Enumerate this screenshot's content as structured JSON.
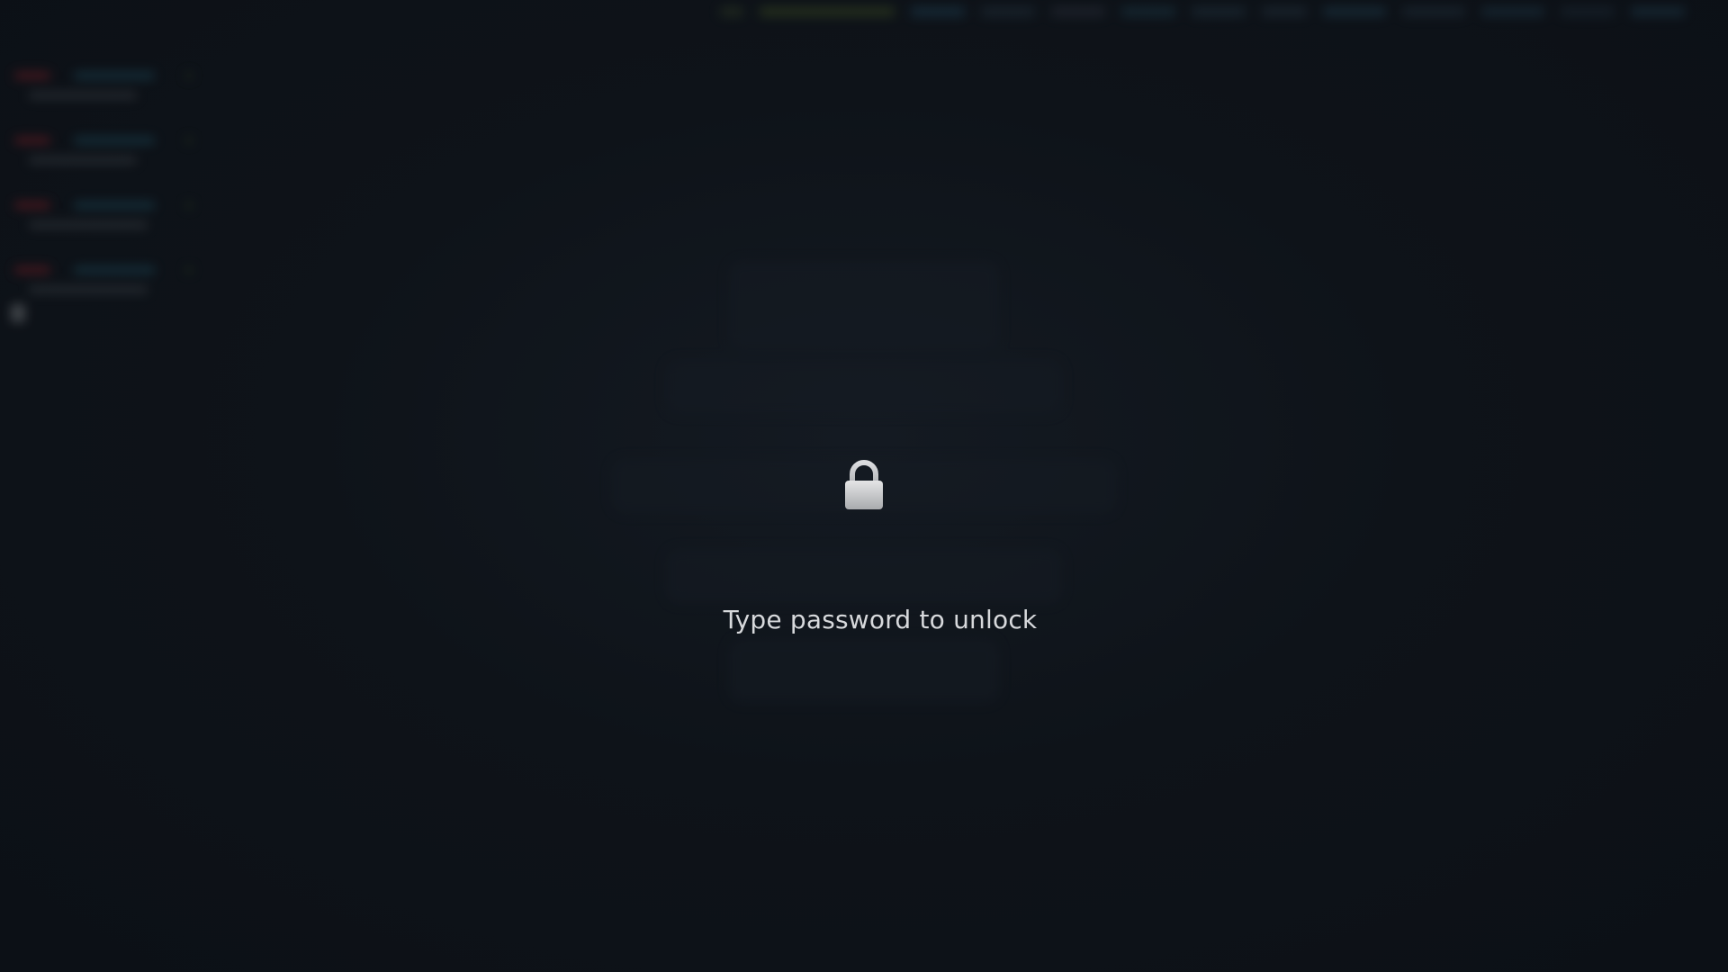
{
  "lock_screen": {
    "icon": "lock-icon",
    "prompt": "Type password to unlock"
  },
  "colors": {
    "background": "#0d1117",
    "text": "#d7d9dc",
    "lock_icon": "#c9cacc"
  }
}
